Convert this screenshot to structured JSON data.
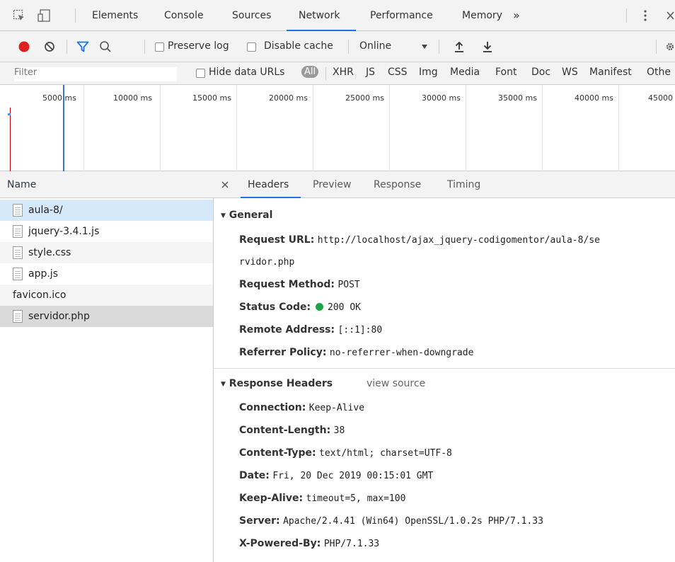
{
  "tabs": [
    "Elements",
    "Console",
    "Sources",
    "Network",
    "Performance",
    "Memory"
  ],
  "active_tab": "Network",
  "toolbar": {
    "preserve_log": "Preserve log",
    "disable_cache": "Disable cache",
    "throttle": "Online"
  },
  "filterbar": {
    "placeholder": "Filter",
    "hide_data_urls": "Hide data URLs",
    "types": [
      "All",
      "XHR",
      "JS",
      "CSS",
      "Img",
      "Media",
      "Font",
      "Doc",
      "WS",
      "Manifest",
      "Othe"
    ]
  },
  "overview": {
    "ticks": [
      "5000 ms",
      "10000 ms",
      "15000 ms",
      "20000 ms",
      "25000 ms",
      "30000 ms",
      "35000 ms",
      "40000 ms",
      "45000"
    ]
  },
  "requests": {
    "header": "Name",
    "items": [
      "aula-8/",
      "jquery-3.4.1.js",
      "style.css",
      "app.js",
      "favicon.ico",
      "servidor.php"
    ]
  },
  "detail_tabs": [
    "Headers",
    "Preview",
    "Response",
    "Timing"
  ],
  "general": {
    "title": "General",
    "request_url_label": "Request URL:",
    "request_url_line1": "http://localhost/ajax_jquery-codigomentor/aula-8/se",
    "request_url_line2": "rvidor.php",
    "method_label": "Request Method:",
    "method": "POST",
    "status_label": "Status Code:",
    "status": "200 OK",
    "status_color": "#1ea446",
    "remote_label": "Remote Address:",
    "remote": "[::1]:80",
    "referrer_label": "Referrer Policy:",
    "referrer": "no-referrer-when-downgrade"
  },
  "response_headers": {
    "title": "Response Headers",
    "view_source": "view source",
    "items": [
      {
        "k": "Connection:",
        "v": "Keep-Alive"
      },
      {
        "k": "Content-Length:",
        "v": "38"
      },
      {
        "k": "Content-Type:",
        "v": "text/html; charset=UTF-8"
      },
      {
        "k": "Date:",
        "v": "Fri, 20 Dec 2019 00:15:01 GMT"
      },
      {
        "k": "Keep-Alive:",
        "v": "timeout=5, max=100"
      },
      {
        "k": "Server:",
        "v": "Apache/2.4.41 (Win64) OpenSSL/1.0.2s PHP/7.1.33"
      },
      {
        "k": "X-Powered-By:",
        "v": "PHP/7.1.33"
      }
    ]
  },
  "colors": {
    "record": "#e0201e",
    "accent": "#1a73e8"
  }
}
